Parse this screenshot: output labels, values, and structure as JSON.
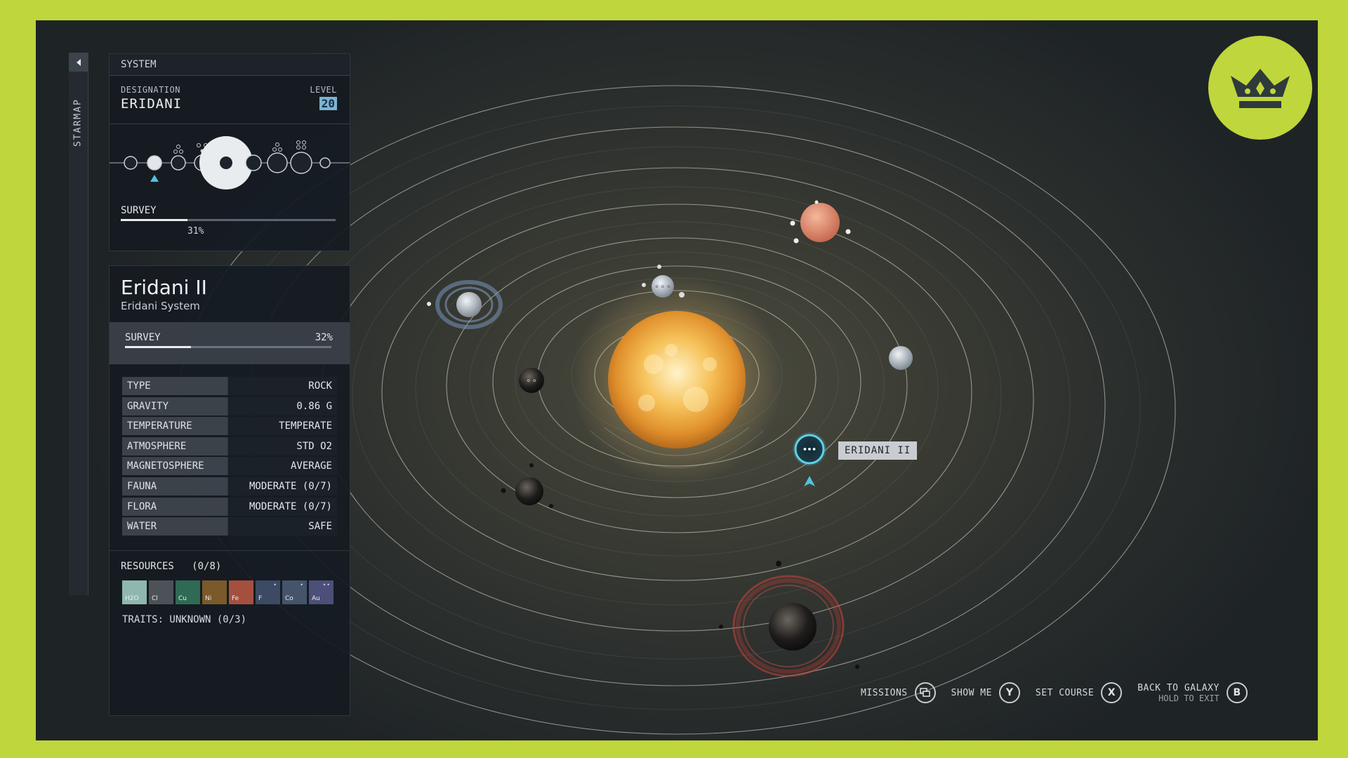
{
  "sidebar": {
    "tab_label": "STARMAP"
  },
  "system_panel": {
    "header": "SYSTEM",
    "designation_label": "DESIGNATION",
    "designation_value": "ERIDANI",
    "level_label": "LEVEL",
    "level_value": "20",
    "survey_label": "SURVEY",
    "survey_percent_text": "31%",
    "survey_progress": 0.31
  },
  "planet_panel": {
    "name": "Eridani II",
    "system": "Eridani System",
    "survey_label": "SURVEY",
    "survey_percent_text": "32%",
    "survey_progress": 0.32,
    "stats": [
      {
        "label": "TYPE",
        "value": "ROCK"
      },
      {
        "label": "GRAVITY",
        "value": "0.86 G"
      },
      {
        "label": "TEMPERATURE",
        "value": "TEMPERATE"
      },
      {
        "label": "ATMOSPHERE",
        "value": "STD O2"
      },
      {
        "label": "MAGNETOSPHERE",
        "value": "AVERAGE"
      },
      {
        "label": "FAUNA",
        "value": "MODERATE (0/7)"
      },
      {
        "label": "FLORA",
        "value": "MODERATE (0/7)"
      },
      {
        "label": "WATER",
        "value": "SAFE"
      }
    ],
    "resources_label": "RESOURCES",
    "resources_count": "(0/8)",
    "resources": [
      {
        "symbol": "H2O",
        "color": "#8fb7b0",
        "dots": ""
      },
      {
        "symbol": "Cl",
        "color": "#4d5258",
        "dots": ""
      },
      {
        "symbol": "Cu",
        "color": "#2f6a55",
        "dots": ""
      },
      {
        "symbol": "Ni",
        "color": "#7a5a2a",
        "dots": ""
      },
      {
        "symbol": "Fe",
        "color": "#a5503f",
        "dots": ""
      },
      {
        "symbol": "F",
        "color": "#3c4a63",
        "dots": "•"
      },
      {
        "symbol": "Co",
        "color": "#44546b",
        "dots": "•"
      },
      {
        "symbol": "Au",
        "color": "#4c4f78",
        "dots": "••"
      }
    ],
    "traits_text": "TRAITS: UNKNOWN (0/3)"
  },
  "map": {
    "selected_planet_label": "ERIDANI II"
  },
  "hints": {
    "missions": "MISSIONS",
    "show_me": "SHOW ME",
    "show_me_key": "Y",
    "set_course": "SET COURSE",
    "set_course_key": "X",
    "back_to_galaxy": "BACK TO GALAXY",
    "hold_to_exit": "HOLD TO EXIT",
    "back_key": "B"
  },
  "colors": {
    "frame_border": "#bfd63c",
    "accent_blue": "#7fb2d0",
    "sun": "#f2b64a",
    "badge_crown": "#2f3a3c"
  },
  "badge": {
    "icon": "crown-icon"
  }
}
